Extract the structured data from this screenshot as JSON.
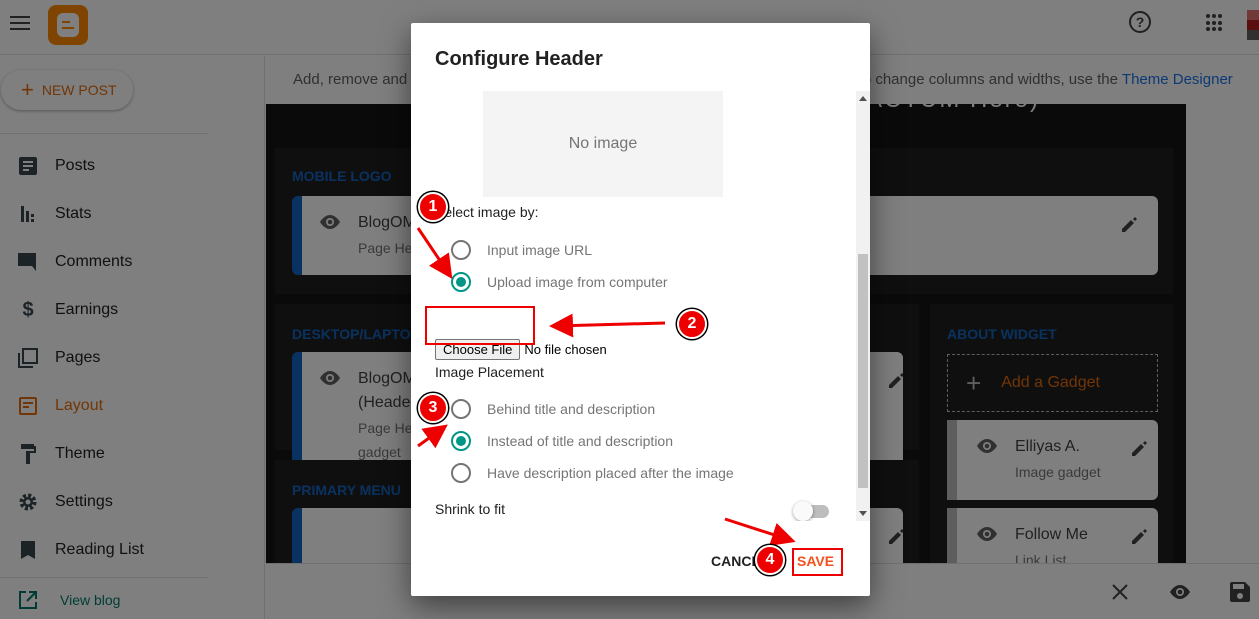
{
  "app": {
    "logo_name": "Blogger"
  },
  "topbar": {
    "help_icon": "?",
    "apps_icon": "apps-grid"
  },
  "sidebar": {
    "new_post_label": "NEW POST",
    "items": [
      {
        "label": "Posts",
        "icon": "posts-icon"
      },
      {
        "label": "Stats",
        "icon": "stats-icon"
      },
      {
        "label": "Comments",
        "icon": "comments-icon"
      },
      {
        "label": "Earnings",
        "icon": "earnings-icon"
      },
      {
        "label": "Pages",
        "icon": "pages-icon"
      },
      {
        "label": "Layout",
        "icon": "layout-icon",
        "active": true
      },
      {
        "label": "Theme",
        "icon": "theme-icon"
      },
      {
        "label": "Settings",
        "icon": "settings-icon"
      },
      {
        "label": "Reading List",
        "icon": "reading-list-icon"
      }
    ],
    "view_blog_label": "View blog"
  },
  "main": {
    "info_prefix": "Add, remove and",
    "info_suffix": "To change columns and widths, use the",
    "info_link": "Theme Designer",
    "canvas_heading": "ACTUM Hero)",
    "panels": {
      "mobile_logo": {
        "title": "MOBILE LOGO",
        "widget_title": "BlogOM",
        "widget_sub": "Page He"
      },
      "desktop": {
        "title": "DESKTOP/LAPTOP",
        "widget_title_1": "BlogOM",
        "widget_title_2": "(Header",
        "widget_sub_1": "Page He",
        "widget_sub_2": "gadget"
      },
      "primary_menu": {
        "title": "PRIMARY MENU"
      },
      "about_widget": {
        "title": "ABOUT WIDGET",
        "add_gadget": "Add a Gadget",
        "gadgets": [
          {
            "title": "Elliyas A.",
            "sub": "Image gadget"
          },
          {
            "title": "Follow Me",
            "sub": "Link List"
          }
        ]
      }
    }
  },
  "dialog": {
    "title": "Configure Header",
    "no_image": "No image",
    "select_label": "Select image by:",
    "select_options": [
      {
        "label": "Input image URL",
        "checked": false
      },
      {
        "label": "Upload image from computer",
        "checked": true
      }
    ],
    "choose_file_label": "Choose File",
    "file_status": "No file chosen",
    "placement_label": "Image Placement",
    "placement_options": [
      {
        "label": "Behind title and description",
        "checked": false
      },
      {
        "label": "Instead of title and description",
        "checked": true
      },
      {
        "label": "Have description placed after the image",
        "checked": false
      }
    ],
    "shrink_label": "Shrink to fit",
    "shrink_enabled": false,
    "cancel_label": "CANCEL",
    "save_label": "SAVE"
  },
  "annotations": [
    "1",
    "2",
    "3",
    "4"
  ],
  "colors": {
    "accent_orange": "#e46b0a",
    "radio_teal": "#009688",
    "save_red": "#f4511e",
    "annotation_red": "#ee0000",
    "panel_title_blue": "#1565c0"
  }
}
